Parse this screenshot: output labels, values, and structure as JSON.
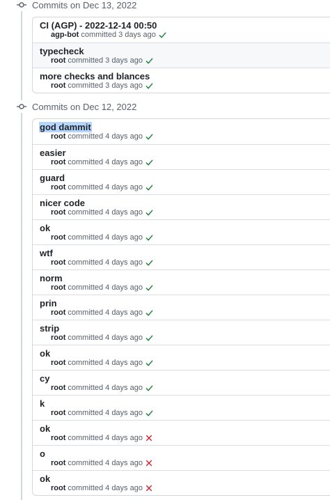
{
  "groups": [
    {
      "label": "Commits on Dec 13, 2022",
      "commits": [
        {
          "message": "CI (AGP) - 2022-12-14 00:50",
          "author": "agp-bot",
          "verb": "committed",
          "time": "3 days ago",
          "status": "success"
        },
        {
          "message": "typecheck",
          "author": "root",
          "verb": "committed",
          "time": "3 days ago",
          "status": "success"
        },
        {
          "message": "more checks and blances",
          "author": "root",
          "verb": "committed",
          "time": "3 days ago",
          "status": "success"
        }
      ]
    },
    {
      "label": "Commits on Dec 12, 2022",
      "commits": [
        {
          "message": "god dammit",
          "author": "root",
          "verb": "committed",
          "time": "4 days ago",
          "status": "success",
          "selected": true
        },
        {
          "message": "easier",
          "author": "root",
          "verb": "committed",
          "time": "4 days ago",
          "status": "success"
        },
        {
          "message": "guard",
          "author": "root",
          "verb": "committed",
          "time": "4 days ago",
          "status": "success"
        },
        {
          "message": "nicer code",
          "author": "root",
          "verb": "committed",
          "time": "4 days ago",
          "status": "success"
        },
        {
          "message": "ok",
          "author": "root",
          "verb": "committed",
          "time": "4 days ago",
          "status": "success"
        },
        {
          "message": "wtf",
          "author": "root",
          "verb": "committed",
          "time": "4 days ago",
          "status": "success"
        },
        {
          "message": "norm",
          "author": "root",
          "verb": "committed",
          "time": "4 days ago",
          "status": "success"
        },
        {
          "message": "prin",
          "author": "root",
          "verb": "committed",
          "time": "4 days ago",
          "status": "success"
        },
        {
          "message": "strip",
          "author": "root",
          "verb": "committed",
          "time": "4 days ago",
          "status": "success"
        },
        {
          "message": "ok",
          "author": "root",
          "verb": "committed",
          "time": "4 days ago",
          "status": "success"
        },
        {
          "message": "cy",
          "author": "root",
          "verb": "committed",
          "time": "4 days ago",
          "status": "success"
        },
        {
          "message": "k",
          "author": "root",
          "verb": "committed",
          "time": "4 days ago",
          "status": "success"
        },
        {
          "message": "ok",
          "author": "root",
          "verb": "committed",
          "time": "4 days ago",
          "status": "failure"
        },
        {
          "message": "o",
          "author": "root",
          "verb": "committed",
          "time": "4 days ago",
          "status": "failure"
        },
        {
          "message": "ok",
          "author": "root",
          "verb": "committed",
          "time": "4 days ago",
          "status": "failure"
        }
      ]
    }
  ],
  "colors": {
    "success": "#1a7f37",
    "failure": "#cf222e",
    "selection": "#b6d7fb"
  },
  "icons": {
    "group": "git-commit-icon",
    "success": "check-icon",
    "failure": "x-icon"
  }
}
